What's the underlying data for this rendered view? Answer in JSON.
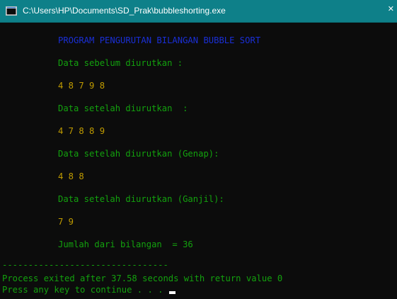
{
  "window": {
    "title": "C:\\Users\\HP\\Documents\\SD_Prak\\bubbleshorting.exe",
    "icon": "console-app-icon"
  },
  "console": {
    "program_title": "PROGRAM PENGURUTAN BILANGAN BUBBLE SORT",
    "before_label": "Data sebelum diurutkan :",
    "before_values": "4 8 7 9 8",
    "after_label": "Data setelah diurutkan  :",
    "after_values": "4 7 8 8 9",
    "even_label": "Data setelah diurutkan (Genap):",
    "even_values": "4 8 8",
    "odd_label": "Data setelah diurutkan (Ganjil):",
    "odd_values": "7 9",
    "sum_line": "Jumlah dari bilangan  = 36",
    "separator": "--------------------------------",
    "exit_message": "Process exited after 37.58 seconds with return value 0",
    "continue_prompt": "Press any key to continue . . . "
  },
  "colors": {
    "titlebar": "#0e8089",
    "console_bg": "#0c0c0c",
    "green_text": "#13a10e",
    "yellow_text": "#c19c00",
    "blue_text": "#1a2fd6"
  }
}
